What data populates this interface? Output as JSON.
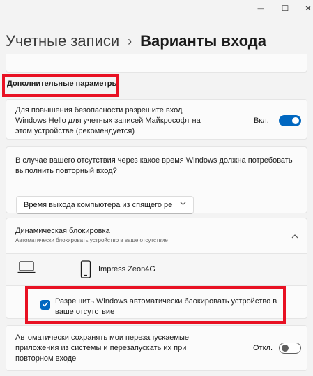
{
  "window": {
    "minimize_glyph": "—",
    "maximize_glyph": "☐",
    "close_glyph": "✕"
  },
  "breadcrumb": {
    "parent": "Учетные записи",
    "separator": "›",
    "current": "Варианты входа"
  },
  "additional": {
    "section_title": "Дополнительные параметры",
    "hello_setting": {
      "text": "Для повышения безопасности разрешите вход Windows Hello для учетных записей Майкрософт на этом устройстве (рекомендуется)",
      "state_label": "Вкл.",
      "on": true
    },
    "away_setting": {
      "text": "В случае вашего отсутствия через какое время Windows должна потребовать выполнить повторный вход?",
      "dropdown_value": "Время выхода компьютера из спящего ре"
    },
    "dynamic_lock": {
      "title": "Динамическая блокировка",
      "subtitle": "Автоматически блокировать устройство в ваше отсутствие",
      "device_name": "Impress Zeon4G",
      "checkbox_label": "Разрешить Windows автоматически блокировать устройство в ваше отсутствие",
      "checked": true
    },
    "restart_apps": {
      "text": "Автоматически сохранять мои перезапускаемые приложения из системы и перезапускать их при повторном входе",
      "state_label": "Откл.",
      "on": false
    }
  },
  "colors": {
    "accent": "#0067c0",
    "highlight": "#e81123"
  },
  "icons": {
    "laptop": "laptop-icon",
    "phone": "phone-icon",
    "chevron_up": "chevron-up-icon",
    "chevron_down": "chevron-down-icon",
    "checkmark": "checkmark-icon"
  }
}
